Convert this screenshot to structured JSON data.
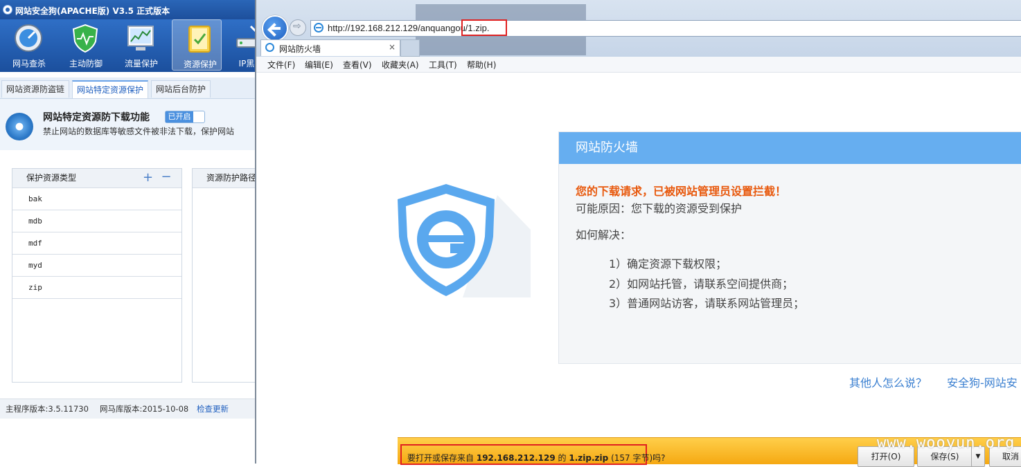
{
  "app": {
    "title": "网站安全狗(APACHE版) V3.5 正式版本",
    "toolbar": [
      {
        "label": "网马查杀",
        "icon": "scan-icon"
      },
      {
        "label": "主动防御",
        "icon": "shield-icon"
      },
      {
        "label": "流量保护",
        "icon": "monitor-icon"
      },
      {
        "label": "资源保护",
        "icon": "folder-icon"
      },
      {
        "label": "IP黑白",
        "icon": "router-icon"
      }
    ],
    "tabs": [
      "网站资源防盗链",
      "网站特定资源保护",
      "网站后台防护"
    ],
    "feature": {
      "title": "网站特定资源防下载功能",
      "status": "已开启",
      "desc": "禁止网站的数据库等敏感文件被非法下载，保护网站"
    },
    "left_panel": {
      "header": "保护资源类型",
      "rows": [
        "bak",
        "mdb",
        "mdf",
        "myd",
        "zip"
      ]
    },
    "right_panel": {
      "header": "资源防护路径"
    },
    "status": {
      "main_version": "主程序版本:3.5.11730",
      "db_version": "网马库版本:2015-10-08",
      "update_link": "检查更新"
    }
  },
  "browser": {
    "url": "http://192.168.212.129/anquangou/1.zip.",
    "tab_title": "网站防火墙",
    "tab_close": "×",
    "menu": [
      "文件(F)",
      "编辑(E)",
      "查看(V)",
      "收藏夹(A)",
      "工具(T)",
      "帮助(H)"
    ],
    "card": {
      "header": "网站防火墙",
      "warning": "您的下载请求，已被网站管理员设置拦截！",
      "reason": "可能原因：您下载的资源受到保护",
      "howto": "如何解决：",
      "steps": [
        "1）确定资源下载权限；",
        "2）如网站托管，请联系空间提供商；",
        "3）普通网站访客，请联系网站管理员；"
      ]
    },
    "links": [
      "其他人怎么说？",
      "安全狗-网站安"
    ],
    "download_bar": {
      "prefix": "要打开或保存来自",
      "host": "192.168.212.129",
      "mid": "的",
      "file": "1.zip.zip",
      "size": "(157 字节)吗?",
      "open": "打开(O)",
      "save": "保存(S)",
      "dropdown": "▼",
      "cancel": "取消"
    },
    "watermark": "www.wooyun.org"
  }
}
